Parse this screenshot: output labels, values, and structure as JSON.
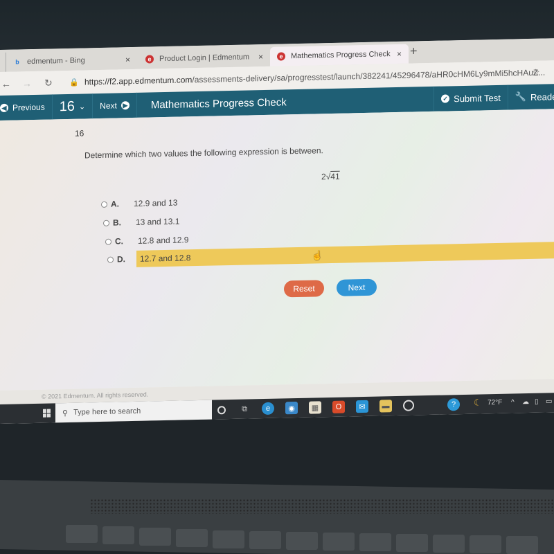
{
  "browser": {
    "tabs": [
      {
        "label": "edmentum - Bing",
        "icon": "bing-icon",
        "active": false
      },
      {
        "label": "Product Login | Edmentum",
        "icon": "edmentum-icon",
        "active": false
      },
      {
        "label": "Mathematics Progress Check",
        "icon": "edmentum-icon",
        "active": true
      }
    ],
    "new_tab": "+",
    "close": "×",
    "url_host": "https://f2.app.edmentum.com",
    "url_path": "/assessments-delivery/sa/progresstest/launch/382241/45296478/aHR0cHM6Ly9mMi5hcHAuZ..."
  },
  "toolbar": {
    "previous_label": "Previous",
    "question_number": "16",
    "next_label": "Next",
    "title": "Mathematics Progress Check",
    "submit_label": "Submit Test",
    "reader_label": "Reader T"
  },
  "question": {
    "number": "16",
    "prompt": "Determine which two values the following expression is between.",
    "expression_coef": "2",
    "expression_radicand": "41",
    "choices": [
      {
        "letter": "A.",
        "text": "12.9 and 13",
        "selected": false
      },
      {
        "letter": "B.",
        "text": "13 and 13.1",
        "selected": false
      },
      {
        "letter": "C.",
        "text": "12.8 and 12.9",
        "selected": false
      },
      {
        "letter": "D.",
        "text": "12.7 and 12.8",
        "selected": true
      }
    ],
    "highlight_color": "#eec95a"
  },
  "actions": {
    "reset_label": "Reset",
    "next_label": "Next",
    "reset_color": "#de6a47",
    "next_color": "#2f95d6"
  },
  "footer": {
    "copyright": "© 2021 Edmentum. All rights reserved."
  },
  "taskbar": {
    "search_placeholder": "Type here to search",
    "weather_temp": "72°F"
  },
  "brand_color": "#1f5f75"
}
